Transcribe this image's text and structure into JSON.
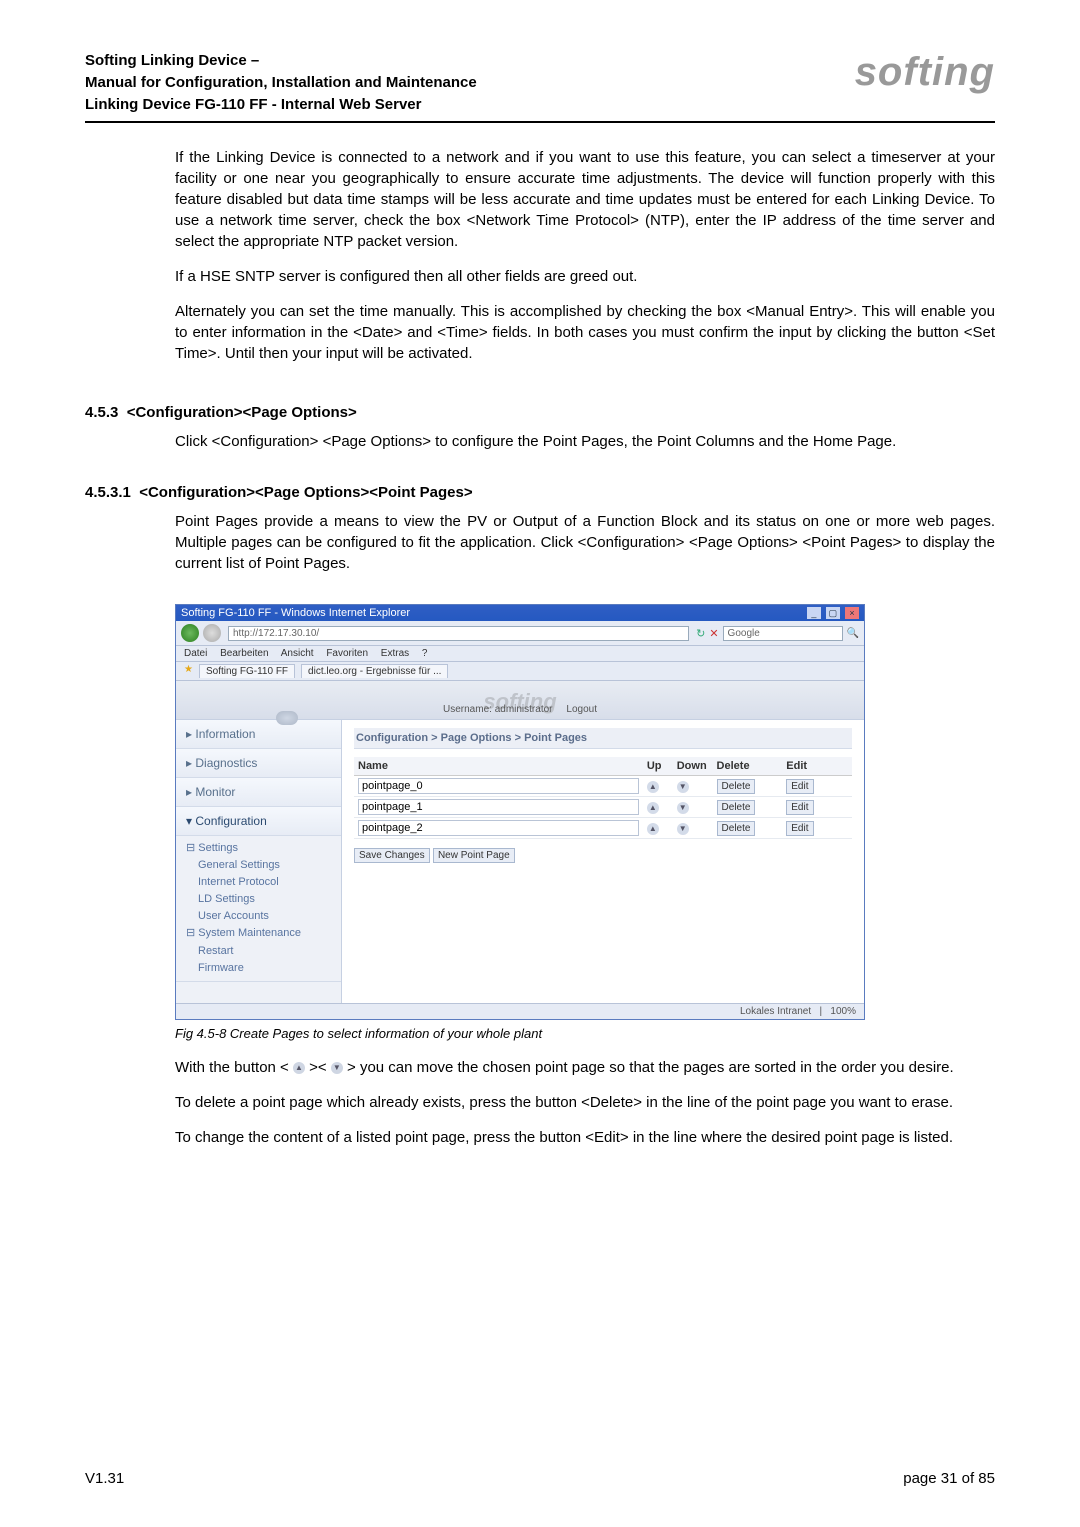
{
  "header": {
    "line1": "Softing Linking Device –",
    "line2": "Manual for Configuration, Installation and Maintenance",
    "line3": "Linking Device FG-110 FF - Internal Web Server",
    "brand": "softing"
  },
  "paragraphs": {
    "p1": "If the Linking Device is connected to a network and if you want to use this feature, you can select a timeserver at your facility or one near you geographically to ensure accurate time adjustments. The device will function properly with this feature disabled but data time stamps will be less accurate and time updates must be entered for each Linking Device. To use a network time server, check the box <Network Time Protocol> (NTP), enter the IP address of the time server and select the appropriate NTP packet version.",
    "p2": "If a HSE SNTP server is configured then all other fields are greed out.",
    "p3": "Alternately you can set the time manually. This is accomplished by checking the box <Manual Entry>. This will enable you to enter information in the <Date> and <Time> fields. In both cases you must confirm the input by clicking the button <Set Time>. Until then your input will be activated."
  },
  "sec453": {
    "num": "4.5.3",
    "title": "<Configuration><Page Options>",
    "p": "Click <Configuration> <Page Options> to configure the Point Pages, the Point Columns and the Home Page."
  },
  "sec4531": {
    "num": "4.5.3.1",
    "title": "<Configuration><Page Options><Point Pages>",
    "p": "Point Pages provide a means to view the PV or Output of a Function Block and its status on one or more web pages. Multiple pages can be configured to fit the application. Click <Configuration> <Page Options> <Point Pages> to display the current list of Point Pages."
  },
  "ie": {
    "title": "Softing FG-110 FF - Windows Internet Explorer",
    "address": "http://172.17.30.10/",
    "search": "Google",
    "menus": [
      "Datei",
      "Bearbeiten",
      "Ansicht",
      "Favoriten",
      "Extras",
      "?"
    ],
    "tabs": [
      "Softing FG-110 FF",
      "dict.leo.org - Ergebnisse für ..."
    ],
    "status_left": "",
    "status_zone": "Lokales Intranet",
    "status_zoom": "100%"
  },
  "app": {
    "brand": "softing",
    "user_label": "Username: administrator",
    "logout": "Logout",
    "nav": [
      "Information",
      "Diagnostics",
      "Monitor",
      "Configuration"
    ],
    "tree": {
      "settings": "Settings",
      "children": [
        "General Settings",
        "Internet Protocol",
        "LD Settings",
        "User Accounts"
      ],
      "sysm": "System Maintenance",
      "sysm_children": [
        "Restart",
        "Firmware"
      ]
    },
    "breadcrumb": "Configuration > Page Options > Point Pages",
    "cols": {
      "name": "Name",
      "up": "Up",
      "down": "Down",
      "del": "Delete",
      "edit": "Edit"
    },
    "rows": [
      {
        "name": "pointpage_0",
        "del": "Delete",
        "edit": "Edit"
      },
      {
        "name": "pointpage_1",
        "del": "Delete",
        "edit": "Edit"
      },
      {
        "name": "pointpage_2",
        "del": "Delete",
        "edit": "Edit"
      }
    ],
    "btn_save": "Save Changes",
    "btn_new": "New Point Page"
  },
  "figcaption": "Fig 4.5-8  Create Pages to select information of your whole plant",
  "after": {
    "p1a": "With the button < ",
    "p1b": " >< ",
    "p1c": " > you can move the chosen point page so that the pages are sorted in the order you desire.",
    "p2": "To delete a point page which already exists, press the button <Delete> in the line of the point page you want to erase.",
    "p3": "To change the content of a listed point page, press the button <Edit> in the line where the desired point page is listed."
  },
  "footer": {
    "left": "V1.31",
    "right": "page 31 of 85"
  }
}
